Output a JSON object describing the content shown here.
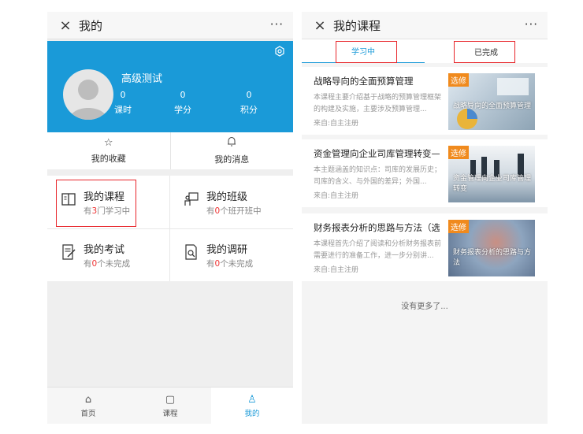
{
  "left": {
    "title": "我的",
    "close_icon": "×",
    "more_icon": "···",
    "profile": {
      "name": "高级测试",
      "stats": [
        {
          "value": "0",
          "label": "课时"
        },
        {
          "value": "0",
          "label": "学分"
        },
        {
          "value": "0",
          "label": "积分"
        }
      ]
    },
    "quick": [
      {
        "icon": "☆",
        "label": "我的收藏"
      },
      {
        "icon": "♫",
        "label": "我的消息"
      }
    ],
    "grid": [
      {
        "title": "我的课程",
        "sub_pre": "有",
        "sub_num": "3",
        "sub_post": "门学习中"
      },
      {
        "title": "我的班级",
        "sub_pre": "有",
        "sub_num": "0",
        "sub_post": "个班开班中"
      },
      {
        "title": "我的考试",
        "sub_pre": "有",
        "sub_num": "0",
        "sub_post": "个未完成"
      },
      {
        "title": "我的调研",
        "sub_pre": "有",
        "sub_num": "0",
        "sub_post": "个未完成"
      }
    ],
    "tabbar": [
      {
        "icon": "⌂",
        "label": "首页"
      },
      {
        "icon": "▢",
        "label": "课程"
      },
      {
        "icon": "♙",
        "label": "我的"
      }
    ]
  },
  "right": {
    "title": "我的课程",
    "close_icon": "×",
    "more_icon": "···",
    "tabs": [
      "学习中",
      "已完成"
    ],
    "courses": [
      {
        "title": "战略导向的全面预算管理",
        "desc": "本课程主要介绍基于战略的预算管理框架的构建及实施，主要涉及预算管理...",
        "source": "来自:自主注册",
        "badge": "选修",
        "thumb_caption": "战略导向的全面预算管理"
      },
      {
        "title": "资金管理向企业司库管理转变——",
        "desc": "本主题涵盖的知识点：司库的发展历史；司库的含义、与外国的差异；外国...",
        "source": "来自:自主注册",
        "badge": "选修",
        "thumb_caption": "资金管理向企业司库管理转变"
      },
      {
        "title": "财务报表分析的思路与方法（选...",
        "desc": "本课程首先介绍了阅读和分析财务报表前需要进行的准备工作，进一步分别讲...",
        "source": "来自:自主注册",
        "badge": "选修",
        "thumb_caption": "财务报表分析的思路与方法"
      }
    ],
    "no_more": "没有更多了..."
  },
  "colors": {
    "accent": "#1a9ad8",
    "highlight": "#e8252a",
    "badge": "#f08a1d"
  }
}
